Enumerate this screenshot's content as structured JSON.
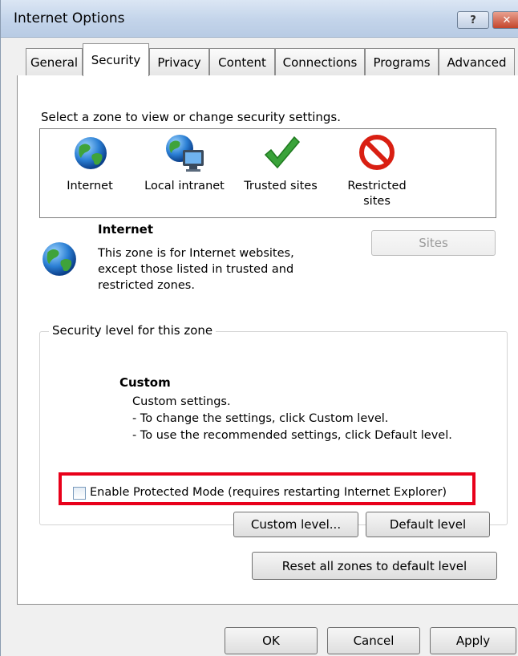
{
  "window": {
    "title": "Internet Options",
    "help_label": "?",
    "close_label": "✕"
  },
  "tabs": [
    {
      "label": "General",
      "active": false
    },
    {
      "label": "Security",
      "active": true
    },
    {
      "label": "Privacy",
      "active": false
    },
    {
      "label": "Content",
      "active": false
    },
    {
      "label": "Connections",
      "active": false
    },
    {
      "label": "Programs",
      "active": false
    },
    {
      "label": "Advanced",
      "active": false
    }
  ],
  "security": {
    "instruction": "Select a zone to view or change security settings.",
    "zones": [
      {
        "label": "Internet",
        "icon": "globe-icon"
      },
      {
        "label": "Local intranet",
        "icon": "intranet-icon"
      },
      {
        "label": "Trusted sites",
        "icon": "checkmark-icon"
      },
      {
        "label": "Restricted sites",
        "icon": "no-entry-icon"
      }
    ],
    "selected_zone": {
      "title": "Internet",
      "description_lines": [
        "This zone is for Internet websites,",
        "except those listed in trusted and",
        "restricted zones."
      ]
    },
    "sites_button": "Sites",
    "level_group_label": "Security level for this zone",
    "level": {
      "title": "Custom",
      "lines": [
        "Custom settings.",
        "- To change the settings, click Custom level.",
        "- To use the recommended settings, click Default level."
      ]
    },
    "protected_mode": {
      "label": "Enable Protected Mode (requires restarting Internet Explorer)",
      "checked": false
    },
    "custom_level_button": "Custom level...",
    "default_level_button": "Default level",
    "reset_all_button": "Reset all zones to default level"
  },
  "footer": {
    "ok": "OK",
    "cancel": "Cancel",
    "apply": "Apply"
  },
  "colors": {
    "highlight_border": "#e8001a",
    "title_bar": "#c3d4ea",
    "close_button": "#c4452c"
  }
}
